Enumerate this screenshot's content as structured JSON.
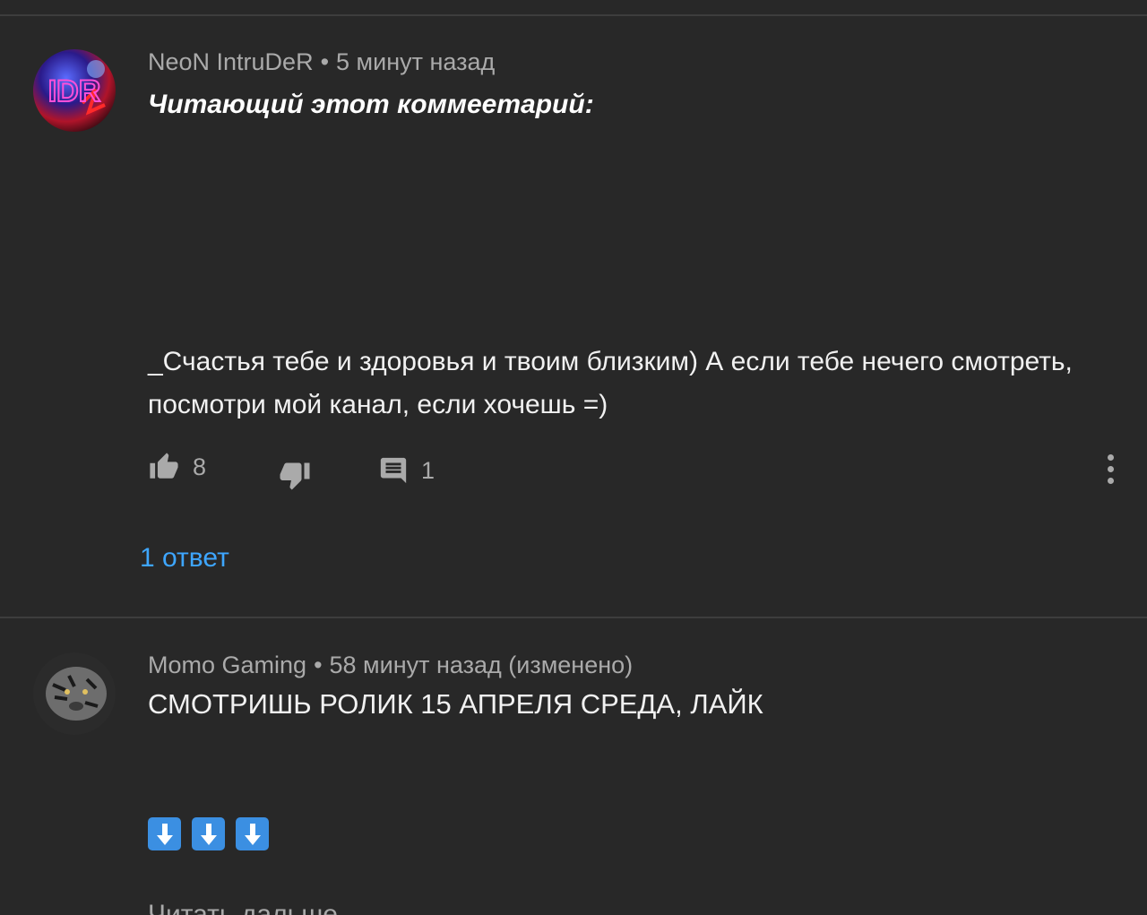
{
  "comments": [
    {
      "author": "NeoN IntruDeR",
      "separator": "•",
      "time": "5 минут назад",
      "title": "Читающий этот коммеетарий:",
      "body": "_Счастья тебе и здоровья и твоим близким) А если тебе нечего смотреть, посмотри мой канал, если хочешь =)",
      "likes": "8",
      "replies_count": "1",
      "replies_link": "1 ответ",
      "avatar_text": "IDR"
    },
    {
      "author": "Momo Gaming",
      "separator": "•",
      "time": "58 минут назад (изменено)",
      "text": "СМОТРИШЬ РОЛИК 15 АПРЕЛЯ СРЕДА, ЛАЙК",
      "emoji": [
        "arrow-down-emoji",
        "arrow-down-emoji",
        "arrow-down-emoji"
      ],
      "read_more": "Читать дальше"
    }
  ],
  "icons": {
    "like": "thumb-up-icon",
    "dislike": "thumb-down-icon",
    "reply": "comment-icon",
    "menu": "more-vertical-icon"
  },
  "colors": {
    "background": "#282828",
    "link": "#3ea6ff",
    "secondary_text": "#aaaaaa",
    "emoji_blue": "#3b8fe2"
  }
}
